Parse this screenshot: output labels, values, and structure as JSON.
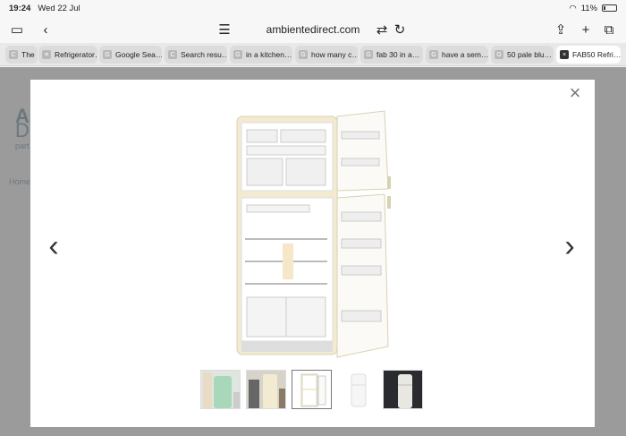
{
  "status": {
    "time": "19:24",
    "date": "Wed 22 Jul",
    "battery": "11%"
  },
  "toolbar": {
    "url": "ambientedirect.com"
  },
  "tabs": [
    {
      "label": "The",
      "icon": "C"
    },
    {
      "label": "Refrigerator…",
      "icon": "≡"
    },
    {
      "label": "Google Sea…",
      "icon": "G"
    },
    {
      "label": "Search resu…",
      "icon": "C"
    },
    {
      "label": "in a kitchen…",
      "icon": "G"
    },
    {
      "label": "how many c…",
      "icon": "G"
    },
    {
      "label": "fab 30 in a…",
      "icon": "G"
    },
    {
      "label": "have a sem…",
      "icon": "G"
    },
    {
      "label": "50 pale blu…",
      "icon": "G"
    },
    {
      "label": "FAB50 Refri…",
      "icon": "×"
    }
  ],
  "background_page": {
    "logo_line1": "A",
    "logo_line2": "D",
    "tagline": "part",
    "breadcrumb": "Home"
  },
  "modal": {
    "close": "×",
    "prev": "‹",
    "next": "›",
    "thumbnail_count": 5,
    "selected_thumbnail": 3
  },
  "colors": {
    "fridge_cream": "#f2ebd2",
    "mint": "#a8d8b9",
    "accent": "#333333"
  }
}
